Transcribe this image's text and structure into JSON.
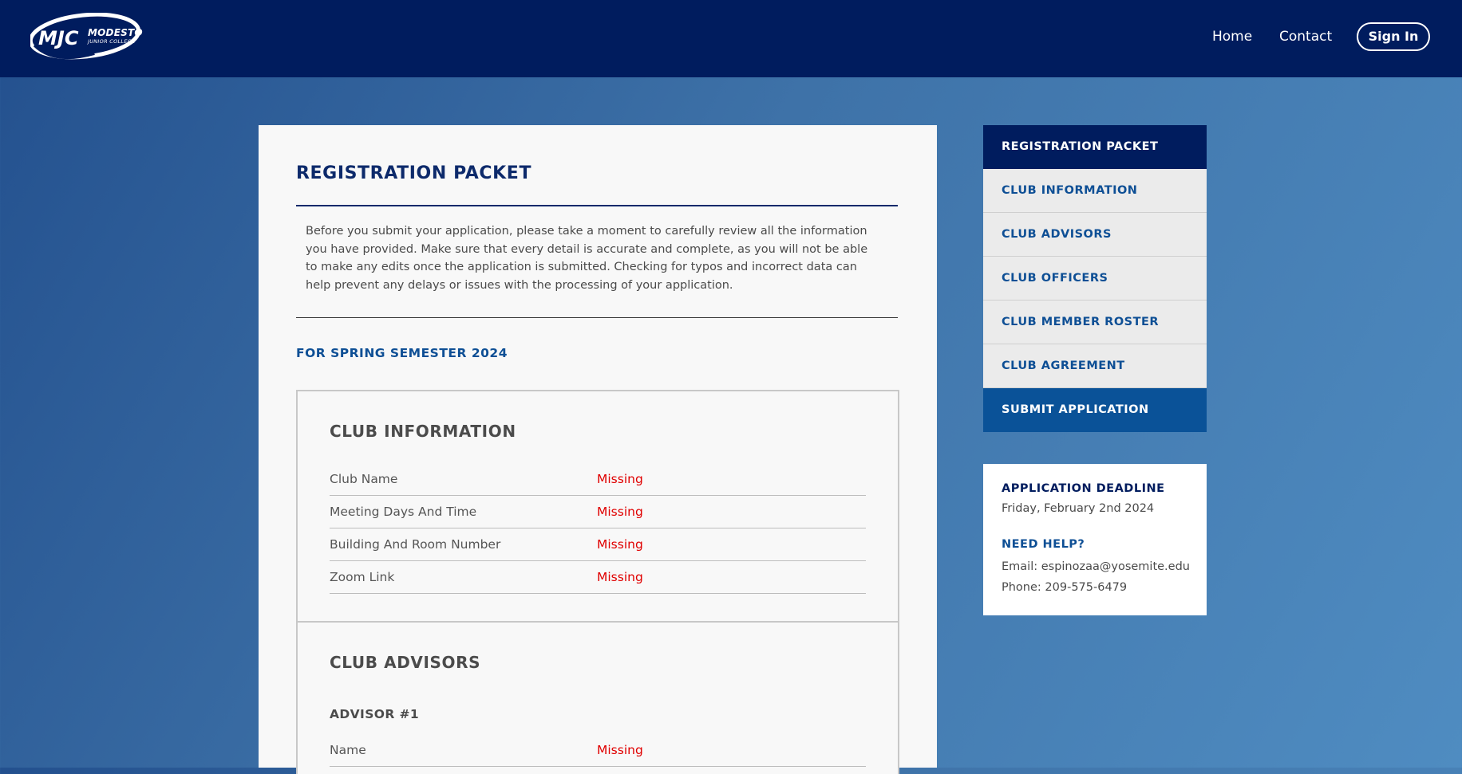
{
  "header": {
    "logo_line1": "MODESTO",
    "logo_line2": "JUNIOR COLLEGE",
    "nav": [
      {
        "label": "Home"
      },
      {
        "label": "Contact"
      }
    ],
    "signin_label": "Sign In"
  },
  "main": {
    "title": "REGISTRATION PACKET",
    "intro": "Before you submit your application, please take a moment to carefully review all the information you have provided. Make sure that every detail is accurate and complete, as you will not be able to make any edits once the application is submitted. Checking for typos and incorrect data can help prevent any delays or issues with the processing of your application.",
    "semester": "FOR SPRING SEMESTER 2024",
    "club_information": {
      "title": "CLUB INFORMATION",
      "fields": [
        {
          "label": "Club Name",
          "value": "Missing"
        },
        {
          "label": "Meeting Days And Time",
          "value": "Missing"
        },
        {
          "label": "Building And Room Number",
          "value": "Missing"
        },
        {
          "label": "Zoom Link",
          "value": "Missing"
        }
      ]
    },
    "club_advisors": {
      "title": "CLUB ADVISORS",
      "advisor_title": "ADVISOR #1",
      "fields": [
        {
          "label": "Name",
          "value": "Missing"
        }
      ]
    }
  },
  "sidebar": {
    "items": [
      {
        "label": "REGISTRATION PACKET"
      },
      {
        "label": "CLUB INFORMATION"
      },
      {
        "label": "CLUB ADVISORS"
      },
      {
        "label": "CLUB OFFICERS"
      },
      {
        "label": "CLUB MEMBER ROSTER"
      },
      {
        "label": "CLUB AGREEMENT"
      },
      {
        "label": "SUBMIT APPLICATION"
      }
    ],
    "deadline_title": "APPLICATION DEADLINE",
    "deadline_date": "Friday, February 2nd 2024",
    "help_title": "NEED HELP?",
    "email": "Email: espinozaa@yosemite.edu",
    "phone": "Phone: 209-575-6479"
  },
  "colors": {
    "header_bg": "#001c5e",
    "heading_navy": "#0d2a6b",
    "accent_blue": "#0e4f95",
    "missing_red": "#e00000"
  }
}
